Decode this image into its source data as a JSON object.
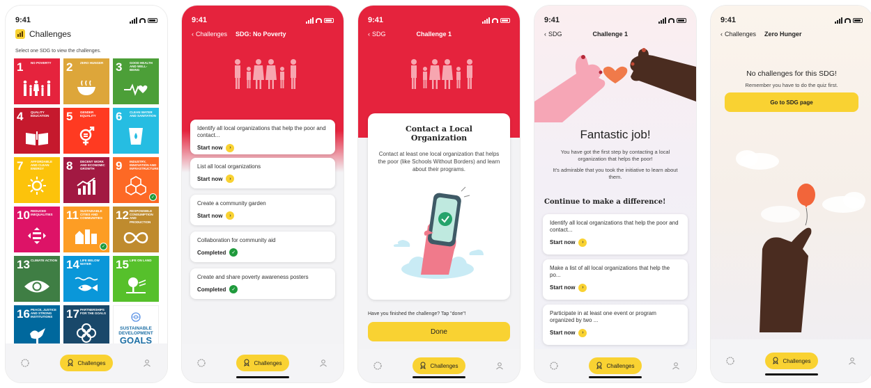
{
  "status": {
    "time": "9:41"
  },
  "tabbar": {
    "challenges_label": "Challenges"
  },
  "screen1": {
    "title": "Challenges",
    "subtitle": "Select one SDG to view the challenges.",
    "tiles": [
      {
        "num": "1",
        "name": "No Poverty",
        "color": "#e5233d",
        "icon": "family-icon"
      },
      {
        "num": "2",
        "name": "Zero Hunger",
        "color": "#dda63a",
        "icon": "bowl-icon"
      },
      {
        "num": "3",
        "name": "Good Health and Well-Being",
        "color": "#4c9f38",
        "icon": "heartbeat-icon"
      },
      {
        "num": "4",
        "name": "Quality Education",
        "color": "#c5192d",
        "icon": "book-icon"
      },
      {
        "num": "5",
        "name": "Gender Equality",
        "color": "#ff3a21",
        "icon": "gender-icon"
      },
      {
        "num": "6",
        "name": "Clean Water and Sanitation",
        "color": "#26bde2",
        "icon": "water-icon"
      },
      {
        "num": "7",
        "name": "Affordable and Clean Energy",
        "color": "#fcc30b",
        "icon": "sun-icon"
      },
      {
        "num": "8",
        "name": "Decent Work and Economic Growth",
        "color": "#a21942",
        "icon": "growth-icon"
      },
      {
        "num": "9",
        "name": "Industry, Innovation and Infrastructure",
        "color": "#fd6925",
        "icon": "cubes-icon"
      },
      {
        "num": "10",
        "name": "Reduced Inequalities",
        "color": "#dd1367",
        "icon": "equal-icon"
      },
      {
        "num": "11",
        "name": "Sustainable Cities and Communities",
        "color": "#fd9d24",
        "icon": "city-icon"
      },
      {
        "num": "12",
        "name": "Responsible Consumption and Production",
        "color": "#bf8b2e",
        "icon": "infinity-icon"
      },
      {
        "num": "13",
        "name": "Climate Action",
        "color": "#3f7e44",
        "icon": "eye-icon"
      },
      {
        "num": "14",
        "name": "Life Below Water",
        "color": "#0a97d9",
        "icon": "fish-icon"
      },
      {
        "num": "15",
        "name": "Life on Land",
        "color": "#56c02b",
        "icon": "tree-icon"
      },
      {
        "num": "16",
        "name": "Peace, Justice and Strong Institutions",
        "color": "#00689d",
        "icon": "dove-icon"
      },
      {
        "num": "17",
        "name": "Partnerships for the Goals",
        "color": "#19486a",
        "icon": "rings-icon"
      }
    ],
    "goals_logo": {
      "line1": "SUSTAINABLE",
      "line2": "DEVELOPMENT",
      "line3": "GOALS"
    }
  },
  "screen2": {
    "back_label": "Challenges",
    "title": "SDG: No Poverty",
    "items": [
      {
        "text": "Identify all local organizations that help the poor and contact...",
        "status": "Start now",
        "done": false
      },
      {
        "text": "List all local organizations",
        "status": "Start now",
        "done": false
      },
      {
        "text": "Create a community garden",
        "status": "Start now",
        "done": false
      },
      {
        "text": "Collaboration for community aid",
        "status": "Completed",
        "done": true
      },
      {
        "text": "Create and share poverty awareness posters",
        "status": "Completed",
        "done": true
      }
    ]
  },
  "screen3": {
    "back_label": "SDG",
    "title": "Challenge 1",
    "card_title": "Contact a Local Organization",
    "card_body": "Contact at least one local organization that helps the poor (like Schools Without Borders) and learn about their programs.",
    "prompt": "Have you finished the challenge? Tap \"done\"!",
    "done_label": "Done"
  },
  "screen4": {
    "back_label": "SDG",
    "title": "Challenge 1",
    "heading": "Fantastic job!",
    "para1": "You have got the first step by contacting a local organization that helps the poor!",
    "para2": "It's admirable that you took the initiative to learn about them.",
    "section": "Continue to make a difference!",
    "items": [
      {
        "text": "Identify all local organizations that help the poor and contact...",
        "status": "Start now"
      },
      {
        "text": "Make a list of all local organizations that help the po...",
        "status": "Start now"
      },
      {
        "text": "Participate in at least one event or program organized by two ...",
        "status": "Start now"
      }
    ]
  },
  "screen5": {
    "back_label": "Challenges",
    "title": "Zero Hunger",
    "heading": "No challenges for this SDG!",
    "sub": "Remember you have to do the quiz first.",
    "button": "Go to SDG page"
  },
  "colors": {
    "accent": "#f9d232",
    "red": "#e5233d",
    "green": "#1f9a3c"
  }
}
